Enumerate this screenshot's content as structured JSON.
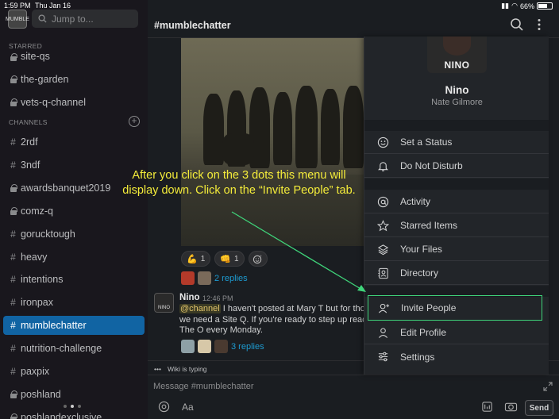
{
  "status_bar": {
    "time": "1:59 PM",
    "date": "Thu Jan 16",
    "battery": "66%"
  },
  "sidebar": {
    "workspace_logo_text": "MUMBLE",
    "jump_placeholder": "Jump to...",
    "starred_label": "STARRED",
    "channels_label": "CHANNELS",
    "starred": [
      {
        "name": "site-qs",
        "private": true
      },
      {
        "name": "the-garden",
        "private": true
      },
      {
        "name": "vets-q-channel",
        "private": true
      }
    ],
    "channels": [
      {
        "name": "2rdf",
        "private": false
      },
      {
        "name": "3ndf",
        "private": false
      },
      {
        "name": "awardsbanquet2019",
        "private": true
      },
      {
        "name": "comz-q",
        "private": true
      },
      {
        "name": "gorucktough",
        "private": false
      },
      {
        "name": "heavy",
        "private": false
      },
      {
        "name": "intentions",
        "private": false
      },
      {
        "name": "ironpax",
        "private": false
      },
      {
        "name": "mumblechatter",
        "private": false,
        "active": true
      },
      {
        "name": "nutrition-challenge",
        "private": false
      },
      {
        "name": "paxpix",
        "private": false
      },
      {
        "name": "poshland",
        "private": true
      },
      {
        "name": "poshlandexclusive",
        "private": true
      }
    ]
  },
  "header": {
    "channel_title": "#mumblechatter"
  },
  "reactions": [
    {
      "emoji": "💪",
      "count": "1"
    },
    {
      "emoji": "👊",
      "count": "1"
    }
  ],
  "thread1": {
    "replies": "2 replies"
  },
  "message": {
    "author": "Nino",
    "time": "12:46 PM",
    "mention": "@channel",
    "line1": " I haven't posted at Mary T but for those",
    "line2": "we need a Site Q. If you're ready to step up reach",
    "line3": "The O every Monday.",
    "overflow_char": "l",
    "avatar_text": "NINO"
  },
  "thread2": {
    "replies": "3 replies"
  },
  "typing": {
    "dots": "•••",
    "text": "Wiki is typing"
  },
  "composer": {
    "placeholder": "Message #mumblechatter",
    "format_label": "Aa",
    "send_label": "Send"
  },
  "annotation": {
    "line1": "After you click on the 3 dots this menu will",
    "line2": "display down. Click on the “Invite People” tab."
  },
  "menu": {
    "display_name": "Nino",
    "real_name": "Nate Gilmore",
    "avatar_text": "NINO",
    "items": {
      "set_status": "Set a Status",
      "dnd": "Do Not Disturb",
      "activity": "Activity",
      "starred": "Starred Items",
      "files": "Your Files",
      "directory": "Directory",
      "invite": "Invite People",
      "edit_profile": "Edit Profile",
      "settings": "Settings"
    }
  },
  "colors": {
    "active_channel": "#1164a3",
    "highlight": "#3fd47a",
    "annotation": "#f4ec3a",
    "link": "#1d9bd1"
  }
}
